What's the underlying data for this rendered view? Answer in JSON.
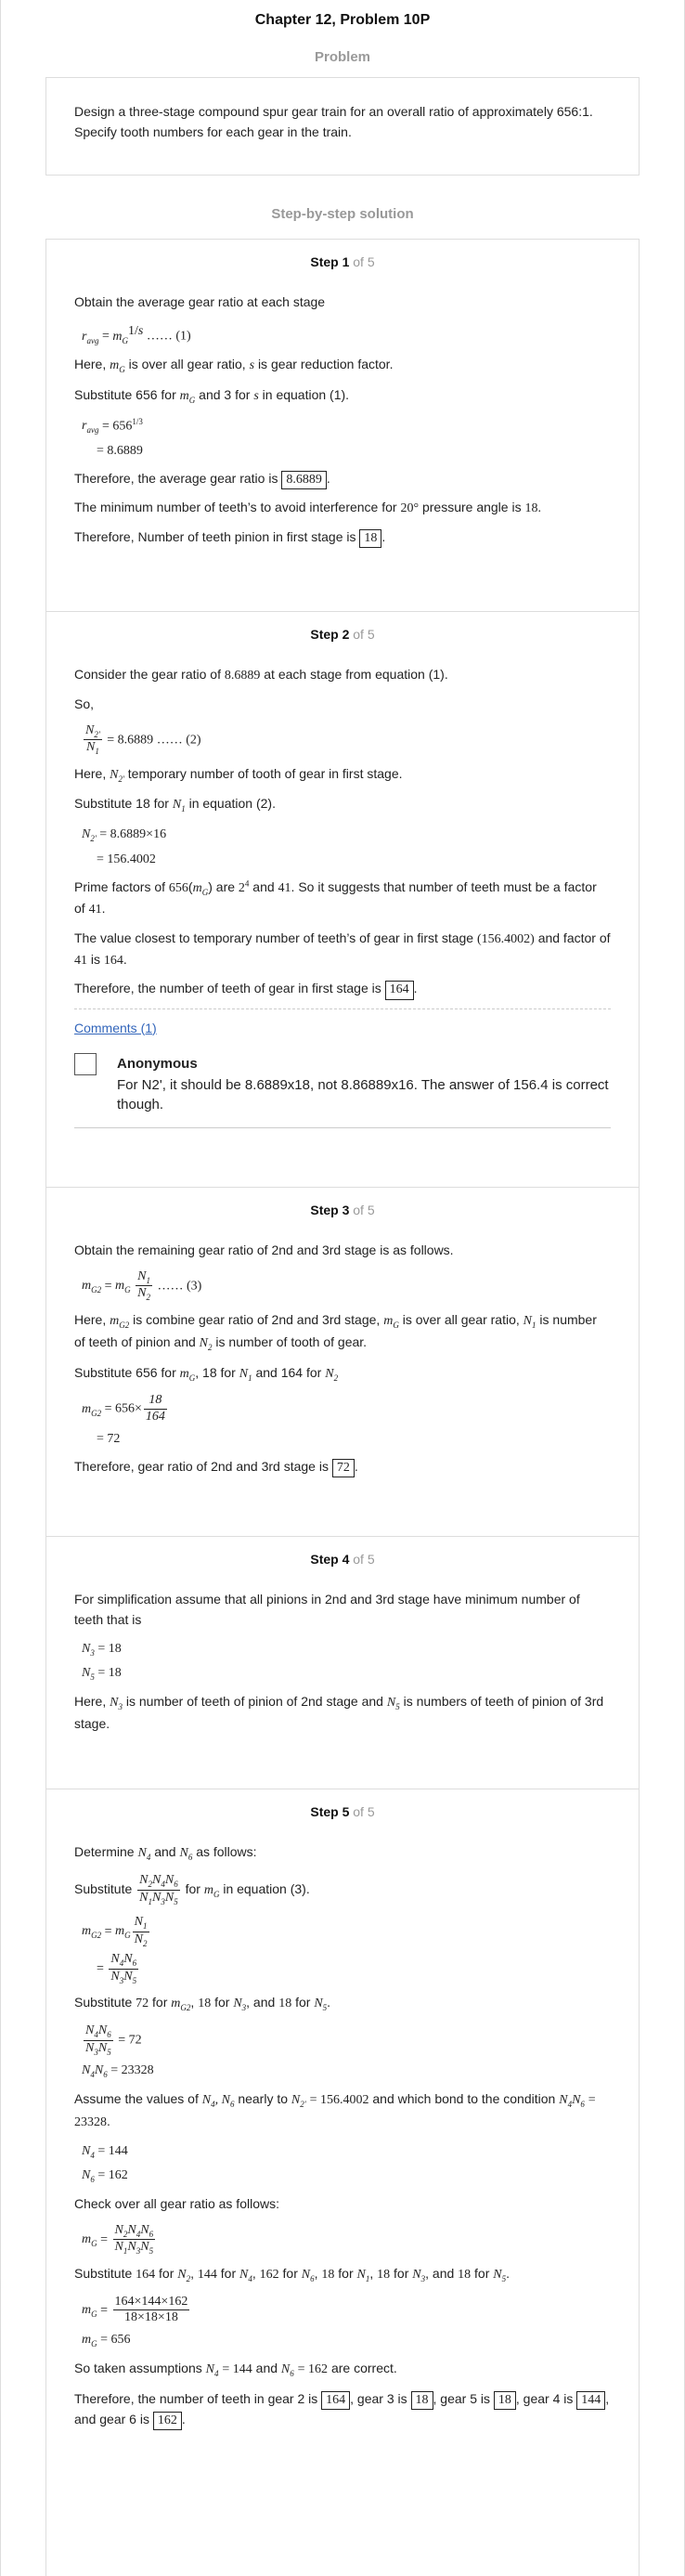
{
  "header": {
    "title": "Chapter 12, Problem 10P"
  },
  "problem": {
    "heading": "Problem",
    "text": "Design a three-stage compound spur gear train for an overall ratio of approximately 656:1. Specify tooth numbers for each gear in the train."
  },
  "solution": {
    "heading": "Step-by-step solution"
  },
  "steps": [
    {
      "label": "Step 1",
      "of": "of 5"
    },
    {
      "label": "Step 2",
      "of": "of 5"
    },
    {
      "label": "Step 3",
      "of": "of 5"
    },
    {
      "label": "Step 4",
      "of": "of 5"
    },
    {
      "label": "Step 5",
      "of": "of 5"
    }
  ],
  "step1": {
    "intro": "Obtain the average gear ratio at each stage",
    "eq1_tag": "…… (1)",
    "here_a": "Here,",
    "here_b": "is over all gear ratio,",
    "here_c": "is gear reduction factor.",
    "sub_a": "Substitute 656 for",
    "sub_b": "and 3 for",
    "sub_c": "in equation (1).",
    "val_656": "656",
    "val_8_6889": "8.6889",
    "conclusion": "Therefore, the average gear ratio is",
    "answer": "8.6889",
    "min_teeth_a": "The minimum number of teeth’s to avoid interference for",
    "pressure_angle": "20°",
    "min_teeth_b": "pressure angle is",
    "min_teeth_value": "18.",
    "pinion_text": "Therefore, Number of teeth pinion in first stage is",
    "pinion_answer": "18"
  },
  "step2": {
    "intro": "Consider the gear ratio of",
    "intro_value": "8.6889",
    "intro_b": "at each stage from equation (1).",
    "so": "So,",
    "eq_rhs": "= 8.6889",
    "eq2_tag": "…… (2)",
    "here_a": "Here,",
    "here_b": "temporary number of tooth of gear in first stage.",
    "sub_a": "Substitute 18 for",
    "sub_b": "in equation (2).",
    "calc1": "= 8.6889×16",
    "calc2": "= 156.4002",
    "prime_a": "Prime factors of",
    "prime_656": "656",
    "prime_b": "are",
    "prime_c": "and",
    "prime_41": "41",
    "prime_d": ". So it suggests that number of teeth must be a factor of",
    "prime_41b": "41",
    "closest_a": "The value closest to temporary number of teeth’s of gear in first stage",
    "closest_val": "(156.4002)",
    "closest_b": "and factor of",
    "closest_41": "41",
    "closest_c": "is",
    "closest_164": "164",
    "conclusion": "Therefore, the number of teeth of gear in first stage is",
    "answer": "164"
  },
  "comments": {
    "link": "Comments (1)",
    "author": "Anonymous",
    "text": "For N2', it should be 8.6889x18, not 8.86889x16. The answer of 156.4 is correct though."
  },
  "step3": {
    "intro": "Obtain the remaining gear ratio of 2nd and 3rd stage is as follows.",
    "eq3_tag": "…… (3)",
    "here_a": "Here,",
    "here_b": "is combine gear ratio of 2nd and 3rd stage,",
    "here_c": "is over all gear ratio,",
    "here_d": "is number of teeth of pinion and",
    "here_e": "is number of tooth of gear.",
    "sub_a": "Substitute 656 for",
    "sub_b": ", 18 for",
    "sub_c": "and 164 for",
    "calc_prefix": "= 656×",
    "frac_num": "18",
    "frac_den": "164",
    "calc2": "= 72",
    "conclusion": "Therefore, gear ratio of 2nd and 3rd stage is",
    "answer": "72"
  },
  "step4": {
    "intro": "For simplification assume that all pinions in 2nd and 3rd stage have minimum number of teeth that is",
    "eq_a": "= 18",
    "eq_b": "= 18",
    "here_a": "Here,",
    "here_b": "is number of teeth of pinion of 2nd stage and",
    "here_c": "is numbers of teeth of pinion of 3rd stage."
  },
  "step5": {
    "determine_a": "Determine",
    "determine_b": "and",
    "determine_c": "as follows:",
    "sub1_a": "Substitute",
    "sub1_b": "for",
    "sub1_c": "in equation (3).",
    "sub2_a": "Substitute",
    "sub2_72": "72",
    "sub2_b": "for",
    "sub2_18a": "18",
    "sub2_c": "for",
    "sub2_d": ", and",
    "sub2_18b": "18",
    "sub2_e": "for",
    "eq_72": "= 72",
    "eq_23328": "= 23328",
    "assume_a": "Assume the values of",
    "assume_b": "nearly to",
    "assume_val": "= 156.4002",
    "assume_c": "and which bond to the condition",
    "assume_eq": "= 23328",
    "n4": "= 144",
    "n6": "= 162",
    "check": "Check over all gear ratio as follows:",
    "sub3_a": "Substitute",
    "sub3_164": "164",
    "sub3_for": "for",
    "sub3_144": "144",
    "sub3_162": "162",
    "sub3_18": "18",
    "sub3_and": ", and",
    "fr_num": "164×144×162",
    "fr_den": "18×18×18",
    "mg_656": "= 656",
    "correct_a": "So taken assumptions",
    "correct_b": "and",
    "correct_c": "are correct.",
    "final_a": "Therefore, the number of teeth in gear 2 is",
    "final_164": "164",
    "final_b": ", gear 3 is",
    "final_18a": "18",
    "final_c": ", gear 5 is",
    "final_18b": "18",
    "final_d": ", gear 4 is",
    "final_144": "144",
    "final_e": ", and gear 6 is",
    "final_162": "162"
  }
}
